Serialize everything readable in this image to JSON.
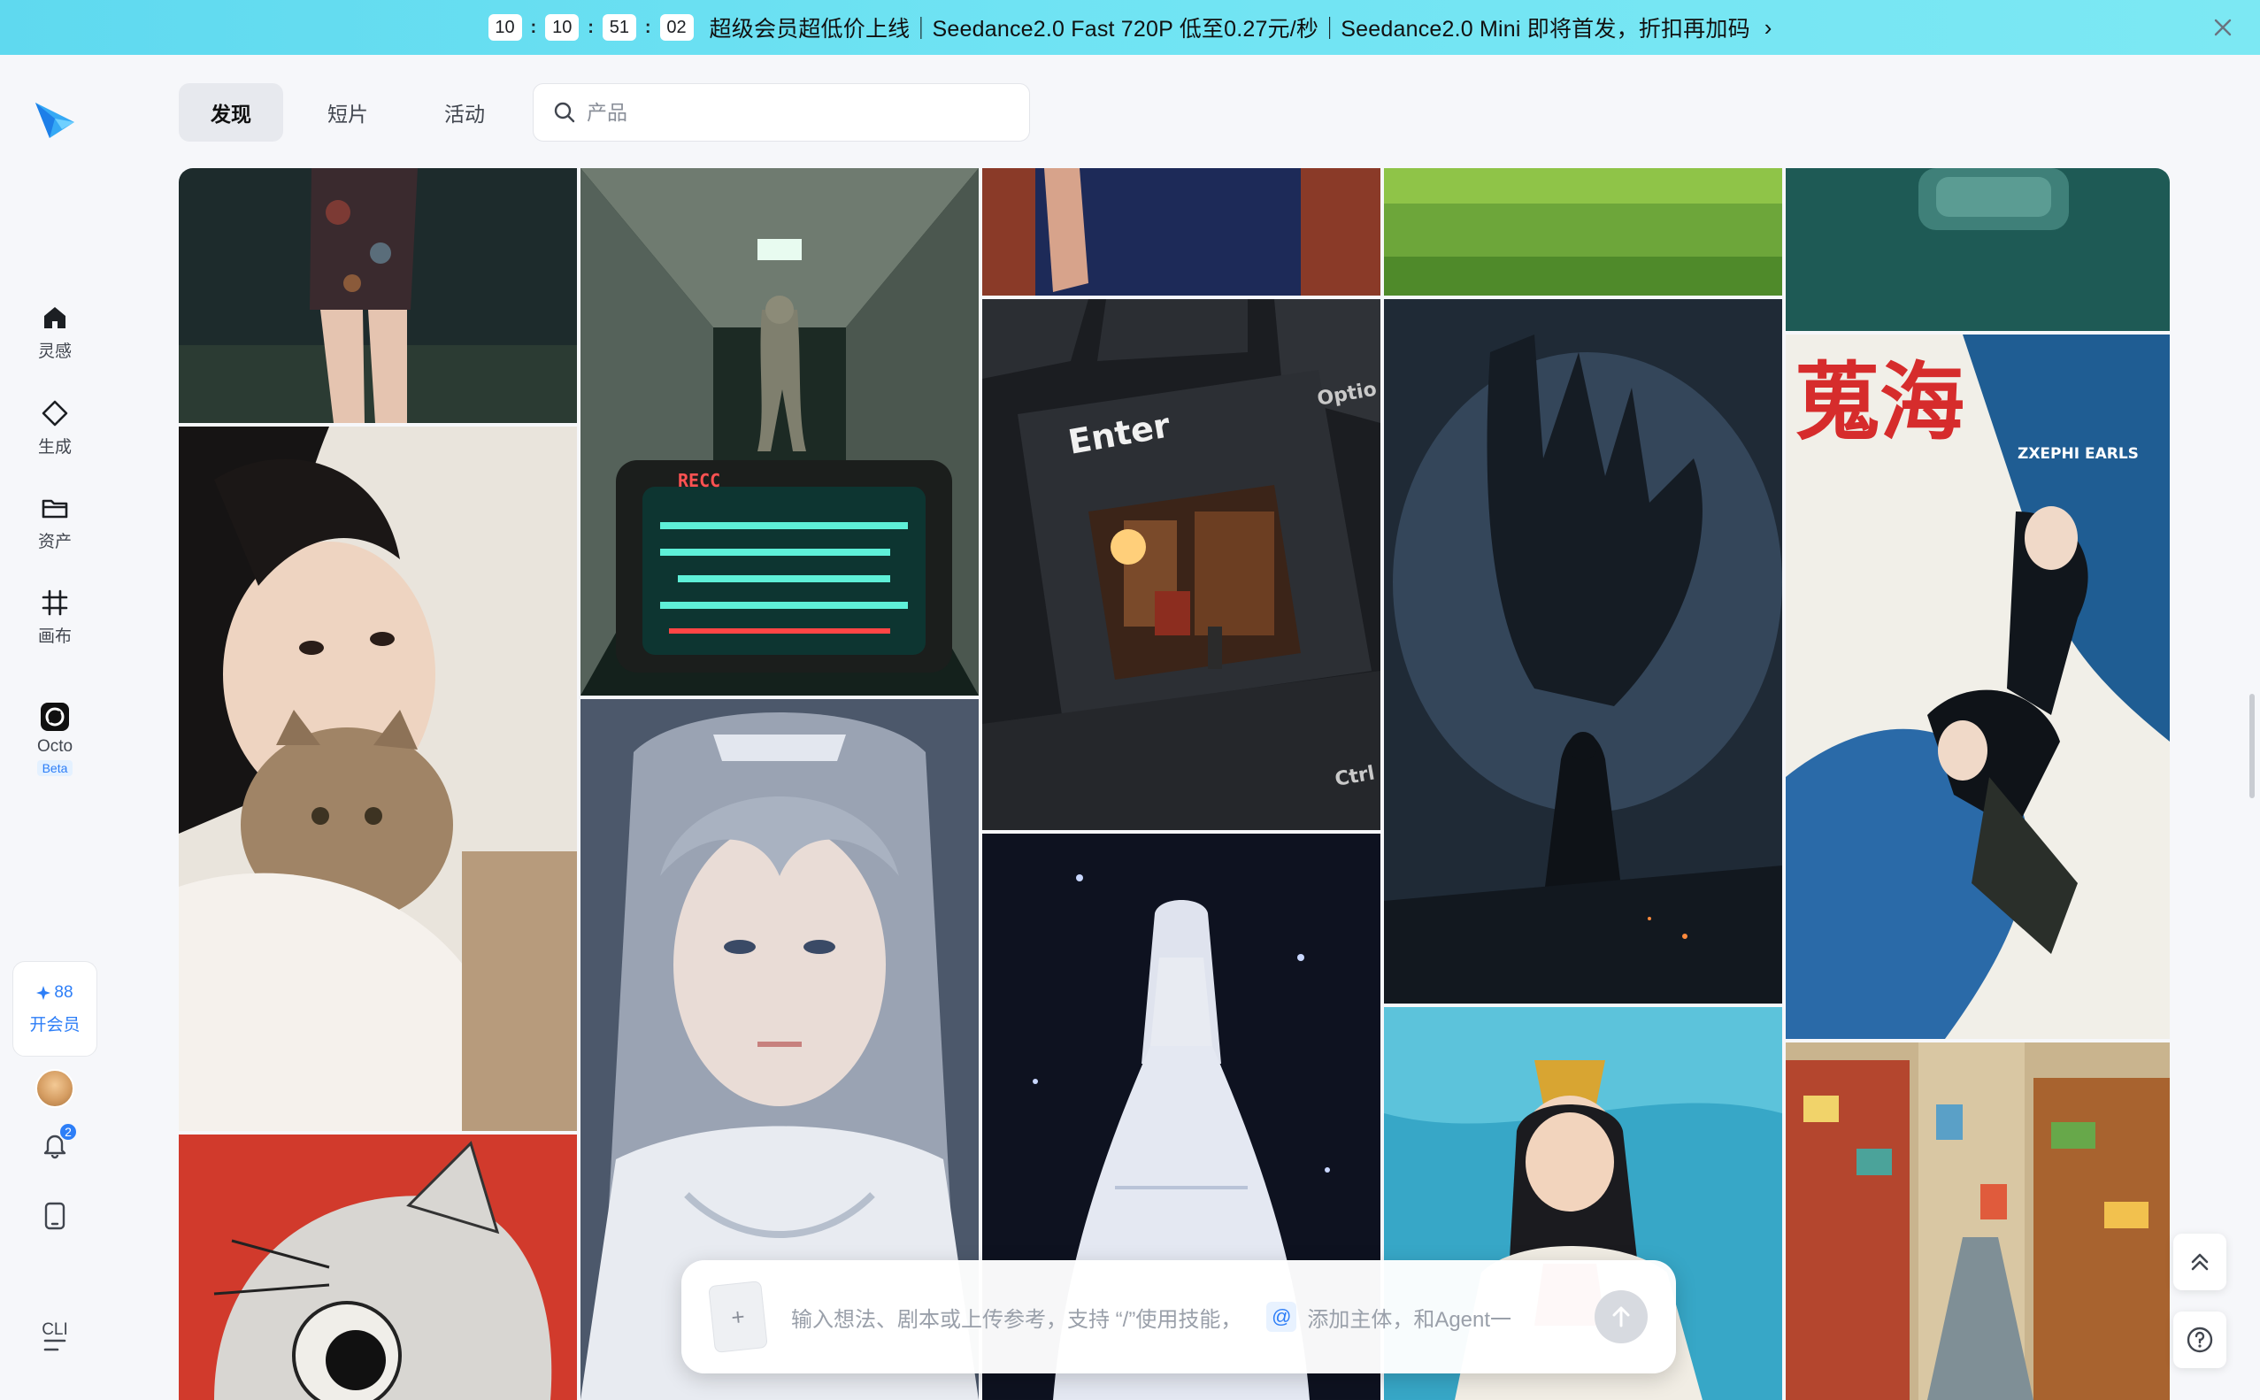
{
  "banner": {
    "countdown": [
      "10",
      "10",
      "51",
      "02"
    ],
    "separator": ":",
    "text": "超级会员超低价上线｜Seedance2.0 Fast 720P 低至0.27元/秒｜Seedance2.0 Mini 即将首发，折扣再加码",
    "chevron": "›"
  },
  "sidebar": {
    "items": [
      {
        "label": "灵感",
        "icon": "home-icon"
      },
      {
        "label": "生成",
        "icon": "diamond-sparkle-icon"
      },
      {
        "label": "资产",
        "icon": "folder-icon"
      },
      {
        "label": "画布",
        "icon": "frame-icon"
      },
      {
        "label": "Octo",
        "icon": "octo-icon",
        "badge": "Beta"
      }
    ],
    "vip": {
      "credits": "88",
      "label": "开会员"
    },
    "notifications": "2",
    "cli": "CLI"
  },
  "tabs": [
    {
      "label": "发现",
      "active": true
    },
    {
      "label": "短片",
      "active": false
    },
    {
      "label": "活动",
      "active": false
    }
  ],
  "search": {
    "placeholder": "产品"
  },
  "gallery": {
    "overlay_texts": {
      "rec": "RECC",
      "enter": "Enter",
      "opt": "Optio",
      "ctrl": "Ctrl",
      "poster_title": "蒐海",
      "poster_sub": "ZXEPHI EARLS"
    }
  },
  "prompt": {
    "upload": "+",
    "text": "输入想法、剧本或上传参考，支持 “/”使用技能，",
    "at": "@",
    "text2": "添加主体，和Agent一"
  },
  "colors": {
    "accent": "#2d7ef7",
    "banner_bg": "#6fe3f3",
    "page_bg": "#f6f7fa"
  }
}
